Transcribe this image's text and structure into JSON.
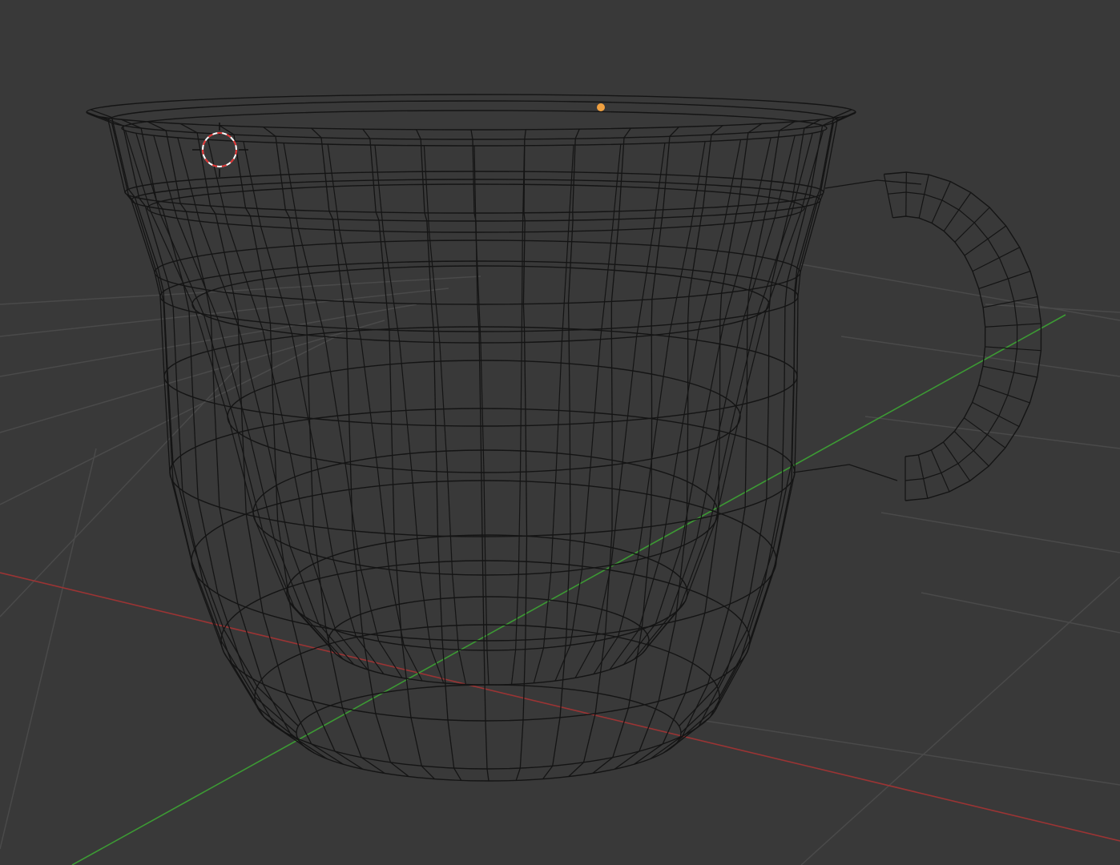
{
  "viewport": {
    "mode": "wireframe",
    "background_color": "#393939",
    "grid_color": "#4a4a4a",
    "x_axis_color": "#9b3434",
    "y_axis_color": "#3c9a34",
    "wire_color": "#141414"
  },
  "scene": {
    "object": "cup",
    "origin_color": "#f0a040",
    "cursor_colors": [
      "#e03030",
      "#ffffff"
    ]
  },
  "icons": {
    "cursor": "3d-cursor-icon",
    "origin": "object-origin-icon"
  }
}
